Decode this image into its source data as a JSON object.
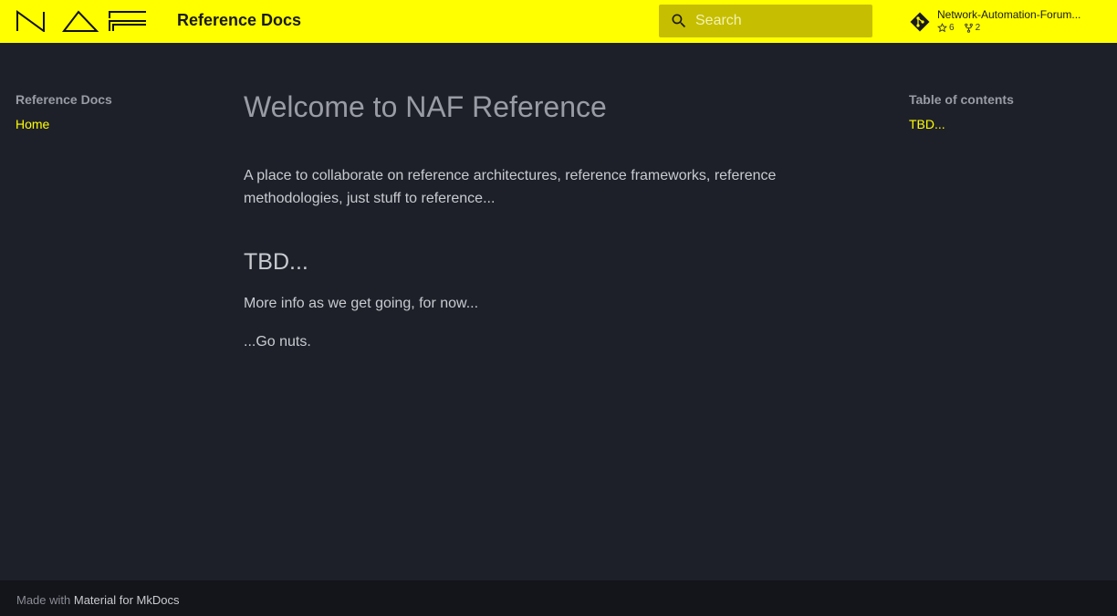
{
  "header": {
    "site_title": "Reference Docs",
    "search_placeholder": "Search",
    "repo_name": "Network-Automation-Forum...",
    "repo_stars": "6",
    "repo_forks": "2",
    "accent_color": "#ffff00"
  },
  "nav": {
    "title": "Reference Docs",
    "items": [
      {
        "label": "Home"
      }
    ]
  },
  "toc": {
    "title": "Table of contents",
    "items": [
      {
        "label": "TBD..."
      }
    ]
  },
  "content": {
    "h1": "Welcome to NAF Reference",
    "intro": "A place to collaborate on reference architectures, reference frameworks, reference methodologies, just stuff to reference...",
    "h2": "TBD...",
    "p2": "More info as we get going, for now...",
    "p3": "...Go nuts."
  },
  "footer": {
    "prefix": "Made with",
    "link": "Material for MkDocs"
  },
  "icons": {
    "logo": "naf-logo",
    "search": "search-icon",
    "repo": "git-icon",
    "star": "star-icon",
    "fork": "fork-icon"
  }
}
